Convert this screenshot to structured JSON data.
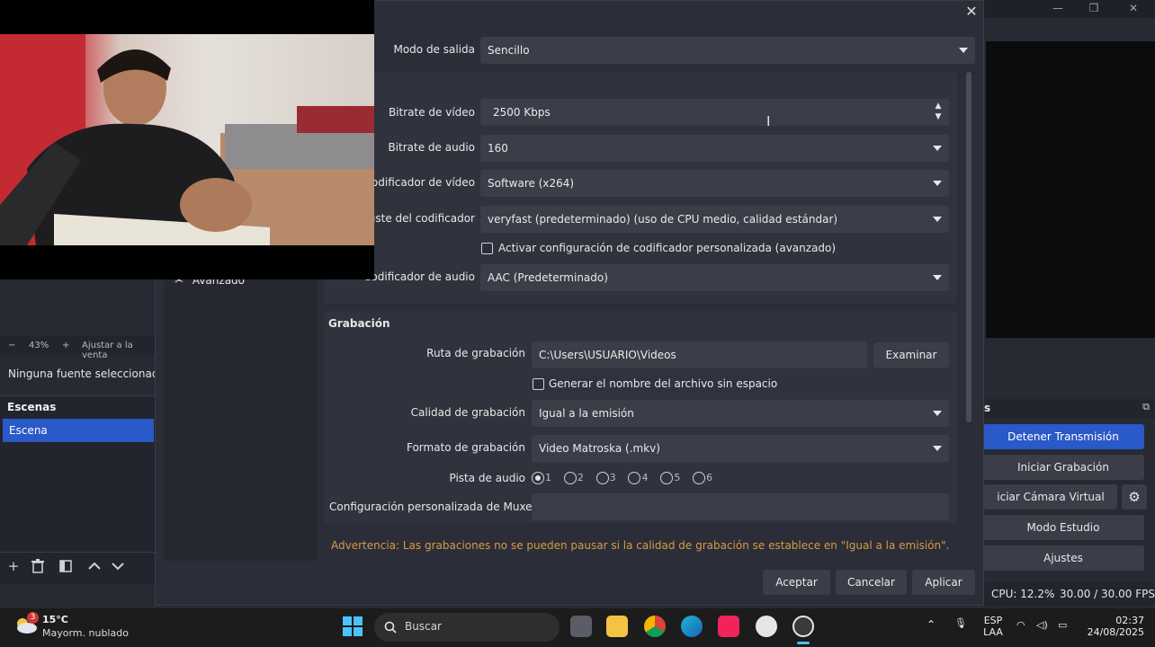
{
  "obs": {
    "zoom_minus": "−",
    "zoom_percent": "43%",
    "zoom_plus": "+",
    "zoom_fit": "Ajustar a la venta",
    "no_source": "Ninguna fuente seleccionad",
    "scenes_title": "Escenas",
    "scene_item": "Escena",
    "controls_title_suffix": "s",
    "controls": {
      "stop_stream": "Detener Transmisión",
      "start_recording": "Iniciar Grabación",
      "virtual_camera": "iciar Cámara Virtual",
      "studio_mode": "Modo Estudio",
      "settings": "Ajustes"
    },
    "status": {
      "cpu": "CPU: 12.2%",
      "fps": "30.00 / 30.00 FPS"
    }
  },
  "dialog": {
    "sidebar_item": "Avanzado",
    "output_mode_label": "Modo de salida",
    "output_mode_value": "Sencillo",
    "streaming": {
      "video_bitrate_label": "Bitrate de vídeo",
      "video_bitrate_value": "2500 Kbps",
      "audio_bitrate_label": "Bitrate de audio",
      "audio_bitrate_value": "160",
      "video_encoder_label": "Codificador de vídeo",
      "video_encoder_value": "Software (x264)",
      "encoder_preset_label": "Ajuste del codificador",
      "encoder_preset_value": "veryfast (predeterminado) (uso de CPU medio, calidad estándar)",
      "custom_encoder_checkbox": "Activar configuración de codificador personalizada (avanzado)",
      "audio_encoder_label": "Codificador de audio",
      "audio_encoder_value": "AAC (Predeterminado)"
    },
    "recording": {
      "section_title": "Grabación",
      "path_label": "Ruta de grabación",
      "path_value": "C:\\Users\\USUARIO\\Videos",
      "browse_button": "Examinar",
      "nospace_checkbox": "Generar el nombre del archivo sin espacio",
      "quality_label": "Calidad de grabación",
      "quality_value": "Igual a la emisión",
      "format_label": "Formato de grabación",
      "format_value": "Video Matroska (.mkv)",
      "audio_track_label": "Pista de audio",
      "audio_tracks": [
        "1",
        "2",
        "3",
        "4",
        "5",
        "6"
      ],
      "muxer_label": "Configuración personalizada de Muxer",
      "muxer_value": ""
    },
    "warning": "Advertencia: Las grabaciones no se pueden pausar si la calidad de grabación se establece en \"Igual a la emisión\".",
    "buttons": {
      "accept": "Aceptar",
      "cancel": "Cancelar",
      "apply": "Aplicar"
    },
    "close": "✕"
  },
  "taskbar": {
    "weather_badge": "3",
    "weather_temp": "15°C",
    "weather_desc": "Mayorm. nublado",
    "search_placeholder": "Buscar",
    "language_top": "ESP",
    "language_bottom": "LAA",
    "time": "02:37",
    "date": "24/08/2025"
  },
  "colors": {
    "accent": "#2a59c8",
    "warning": "#d89a43",
    "dialog_bg": "#2b2e38"
  }
}
